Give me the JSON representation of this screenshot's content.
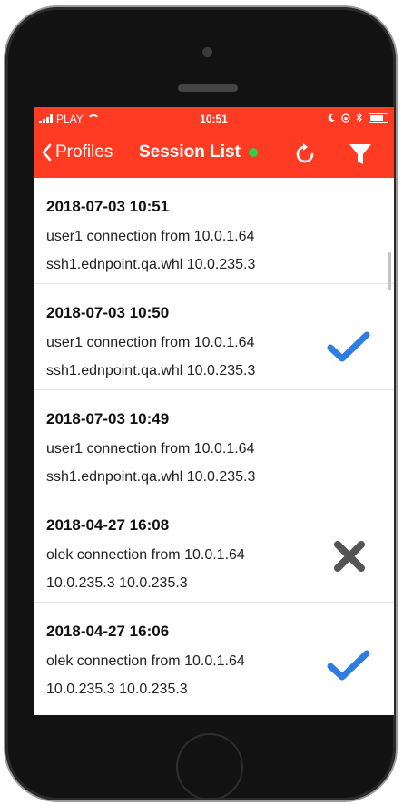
{
  "status": {
    "carrier": "PLAY",
    "time": "10:51"
  },
  "nav": {
    "back_label": "Profiles",
    "title": "Session List"
  },
  "sessions": [
    {
      "time": "2018-07-03 10:51",
      "line1": "user1 connection from 10.0.1.64",
      "line2": "ssh1.ednpoint.qa.whl 10.0.235.3",
      "mark": "none"
    },
    {
      "time": "2018-07-03 10:50",
      "line1": "user1 connection from 10.0.1.64",
      "line2": "ssh1.ednpoint.qa.whl 10.0.235.3",
      "mark": "checkmark"
    },
    {
      "time": "2018-07-03 10:49",
      "line1": "user1 connection from 10.0.1.64",
      "line2": "ssh1.ednpoint.qa.whl 10.0.235.3",
      "mark": "none"
    },
    {
      "time": "2018-04-27 16:08",
      "line1": "olek connection from 10.0.1.64",
      "line2": "10.0.235.3 10.0.235.3",
      "mark": "cross"
    },
    {
      "time": "2018-04-27 16:06",
      "line1": "olek connection from 10.0.1.64",
      "line2": "10.0.235.3 10.0.235.3",
      "mark": "checkmark"
    }
  ],
  "colors": {
    "accent": "#ff3b24",
    "online": "#2fd04a",
    "check": "#2f7de1",
    "cross": "#555555"
  }
}
